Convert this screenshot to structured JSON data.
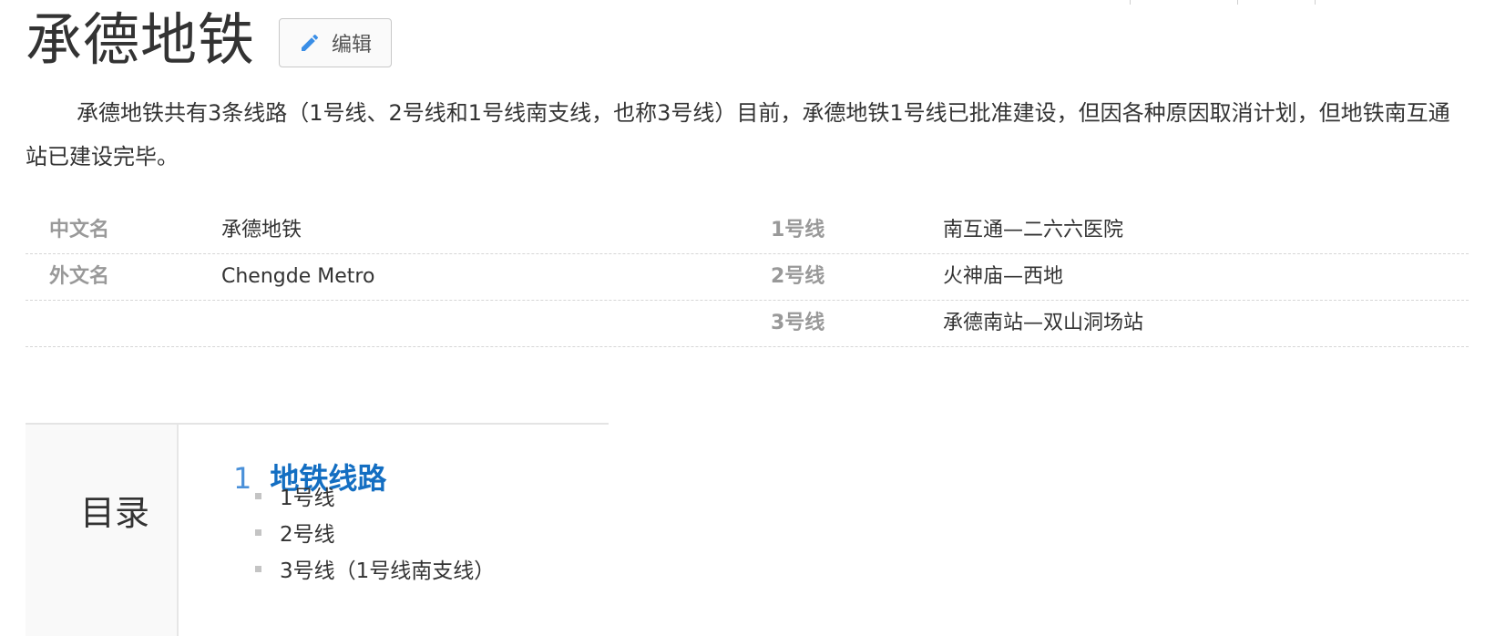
{
  "title": "承德地铁",
  "edit_label": "编辑",
  "summary": "承德地铁共有3条线路（1号线、2号线和1号线南支线，也称3号线）目前，承德地铁1号线已批准建设，但因各种原因取消计划，但地铁南互通站已建设完毕。",
  "info": {
    "rows": [
      {
        "k1": "中文名",
        "v1": "承德地铁",
        "k2": "1号线",
        "v2": "南互通—二六六医院"
      },
      {
        "k1": "外文名",
        "v1": "Chengde Metro",
        "k2": "2号线",
        "v2": "火神庙—西地"
      },
      {
        "k1": "",
        "v1": "",
        "k2": "3号线",
        "v2": "承德南站—双山洞场站"
      }
    ]
  },
  "toc": {
    "title": "目录",
    "main_number": "1",
    "main_heading": "地铁线路",
    "items": [
      "1号线",
      "2号线",
      "3号线（1号线南支线）"
    ]
  },
  "colors": {
    "link": "#136ec2",
    "toc_number": "#4a90d9",
    "label_gray": "#999999"
  }
}
